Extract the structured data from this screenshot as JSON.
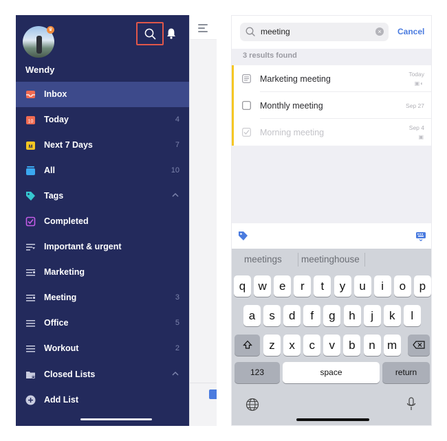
{
  "left_screen": {
    "user": {
      "name": "Wendy"
    },
    "icons": {
      "search": "search-icon",
      "notifications": "bell-icon",
      "pro_badge": "crown-icon"
    },
    "nav": [
      {
        "id": "inbox",
        "label": "Inbox",
        "count": "",
        "icon": "inbox-icon",
        "active": true
      },
      {
        "id": "today",
        "label": "Today",
        "count": "4",
        "icon": "calendar-today-icon"
      },
      {
        "id": "next7",
        "label": "Next 7 Days",
        "count": "7",
        "icon": "calendar-week-icon"
      },
      {
        "id": "all",
        "label": "All",
        "count": "10",
        "icon": "stack-icon"
      },
      {
        "id": "tags",
        "label": "Tags",
        "count": "",
        "icon": "tag-icon",
        "expanded": true
      },
      {
        "id": "completed",
        "label": "Completed",
        "count": "",
        "icon": "checkbox-icon"
      },
      {
        "id": "important",
        "label": "Important & urgent",
        "count": "",
        "icon": "filter-icon"
      },
      {
        "id": "marketing",
        "label": "Marketing",
        "count": "",
        "icon": "filter-list-icon"
      },
      {
        "id": "meeting",
        "label": "Meeting",
        "count": "3",
        "icon": "filter-list-icon"
      },
      {
        "id": "office",
        "label": "Office",
        "count": "5",
        "icon": "list-icon"
      },
      {
        "id": "workout",
        "label": "Workout",
        "count": "2",
        "icon": "list-icon"
      },
      {
        "id": "closed",
        "label": "Closed Lists",
        "count": "",
        "icon": "folder-closed-icon",
        "expanded": true
      },
      {
        "id": "addlist",
        "label": "Add List",
        "count": "",
        "icon": "plus-circle-icon"
      }
    ],
    "colors": {
      "sidebar_bg": "#232a5c",
      "active_row": "#3d4a8b",
      "highlight_border": "#e0574a"
    }
  },
  "right_screen": {
    "search": {
      "value": "meeting",
      "cancel_label": "Cancel"
    },
    "results_label": "3 results found",
    "results": [
      {
        "title": "Marketing meeting",
        "date": "Today",
        "meta": "▣◐",
        "icon": "note-icon",
        "completed": false
      },
      {
        "title": "Monthly meeting",
        "date": "Sep 27",
        "meta": "",
        "icon": "checkbox-icon",
        "completed": false
      },
      {
        "title": "Morning meeting",
        "date": "Sep 4",
        "meta": "▣",
        "icon": "checked-box-icon",
        "completed": true
      }
    ],
    "toolbar": {
      "left_icon": "tag-icon",
      "right_icon": "keyboard-icon"
    },
    "keyboard": {
      "suggestions": [
        "meetings",
        "meetinghouse"
      ],
      "row1": [
        "q",
        "w",
        "e",
        "r",
        "t",
        "y",
        "u",
        "i",
        "o",
        "p"
      ],
      "row2": [
        "a",
        "s",
        "d",
        "f",
        "g",
        "h",
        "j",
        "k",
        "l"
      ],
      "row3": [
        "z",
        "x",
        "c",
        "v",
        "b",
        "n",
        "m"
      ],
      "numbers_label": "123",
      "space_label": "space",
      "return_label": "return"
    },
    "colors": {
      "accent": "#4a7bdf",
      "result_marker": "#f5c623"
    }
  }
}
